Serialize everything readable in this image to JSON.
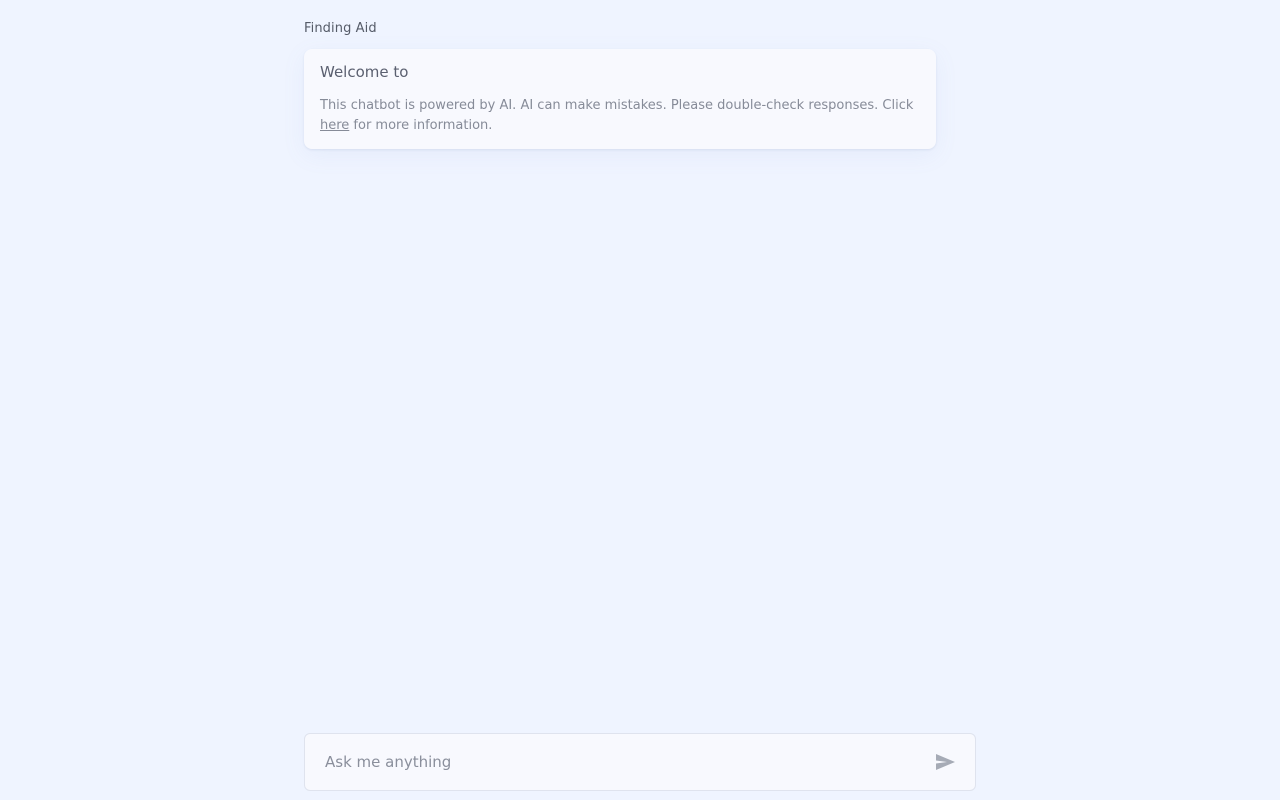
{
  "header": {
    "title": "Finding Aid"
  },
  "welcome": {
    "heading": "Welcome to",
    "disclaimer_before_link": "This chatbot is powered by AI. AI can make mistakes. Please double-check responses. Click ",
    "link_text": "here",
    "disclaimer_after_link": " for more information."
  },
  "composer": {
    "placeholder": "Ask me anything",
    "value": "",
    "send_icon": "send-icon"
  },
  "colors": {
    "background": "#eff4ff",
    "card": "#f8f9fe",
    "icon": "#a6abb6"
  }
}
